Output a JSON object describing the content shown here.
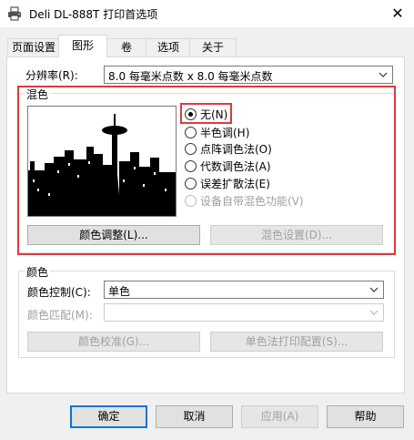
{
  "window": {
    "title": "Deli DL-888T 打印首选项",
    "close_glyph": "✕"
  },
  "tabs": [
    {
      "label": "页面设置",
      "active": false
    },
    {
      "label": "图形",
      "active": true
    },
    {
      "label": "卷",
      "active": false
    },
    {
      "label": "选项",
      "active": false
    },
    {
      "label": "关于",
      "active": false
    }
  ],
  "resolution": {
    "label": "分辨率(R):",
    "value": "8.0 每毫米点数 x 8.0 每毫米点数"
  },
  "dithering": {
    "group_label": "混色",
    "options": [
      {
        "label": "无(N)",
        "checked": true,
        "enabled": true
      },
      {
        "label": "半色调(H)",
        "checked": false,
        "enabled": true
      },
      {
        "label": "点阵调色法(O)",
        "checked": false,
        "enabled": true
      },
      {
        "label": "代数调色法(A)",
        "checked": false,
        "enabled": true
      },
      {
        "label": "误差扩散法(E)",
        "checked": false,
        "enabled": true
      },
      {
        "label": "设备自带混色功能(V)",
        "checked": false,
        "enabled": false
      }
    ],
    "color_adjust_button": "颜色调整(L)...",
    "dither_settings_button": "混色设置(D)..."
  },
  "color": {
    "group_label": "颜色",
    "control_label": "颜色控制(C):",
    "control_value": "单色",
    "match_label": "颜色匹配(M):",
    "match_value": "",
    "calibrate_button": "颜色校准(G)...",
    "mono_print_button": "单色法打印配置(S)..."
  },
  "footer": {
    "ok": "确定",
    "cancel": "取消",
    "apply": "应用(A)",
    "help": "帮助"
  },
  "colors": {
    "highlight_red": "#e03a3a",
    "default_button_border": "#0078d7",
    "disabled_text": "#a0a0a0"
  }
}
